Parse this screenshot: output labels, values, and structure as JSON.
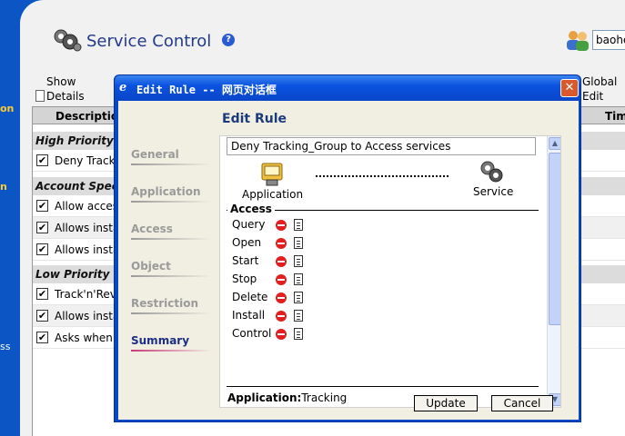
{
  "app": {
    "title": "Service Control",
    "help": "?",
    "username": "baohe",
    "left_nav": [
      {
        "text": "on",
        "color": "yellow"
      },
      {
        "text": "n",
        "color": "yellow"
      },
      {
        "text": "ss",
        "color": "white"
      }
    ]
  },
  "toolbar": {
    "show_details": "Show Details",
    "global_edit": "Global Edit"
  },
  "table": {
    "headers": [
      "Description",
      "Tim"
    ],
    "groups": [
      {
        "label": "High Priority",
        "rows": [
          "Deny Track"
        ]
      },
      {
        "label": "Account Speci",
        "rows": [
          "Allow acces",
          "Allows insta",
          "Allows insta"
        ]
      },
      {
        "label": "Low Priority R",
        "rows": [
          "Track'n'Rev",
          "Allows insta",
          "Asks when"
        ]
      }
    ],
    "check_mark": "✔"
  },
  "dialog": {
    "title": "Edit Rule -- 网页对话框",
    "close": "✕",
    "heading": "Edit Rule",
    "tabs": [
      "General",
      "Application",
      "Access",
      "Object",
      "Restriction",
      "Summary"
    ],
    "active_tab": "Summary",
    "rule_name": "Deny Tracking_Group to Access services",
    "app_label": "Application",
    "service_label": "Service",
    "access_title": "Access",
    "permissions": [
      "Query",
      "Open",
      "Start",
      "Stop",
      "Delete",
      "Install",
      "Control"
    ],
    "application_key": "Application:",
    "application_value": "Tracking",
    "update_button": "Update",
    "cancel_button": "Cancel",
    "scroll_up": "▲",
    "scroll_down": "▼"
  },
  "colors": {
    "nav_blue": "#0b56c4",
    "title_blue": "#223a8a",
    "deny_red": "#e02020",
    "active_tab": "#1b2e85",
    "active_underline": "#c83a7c"
  }
}
